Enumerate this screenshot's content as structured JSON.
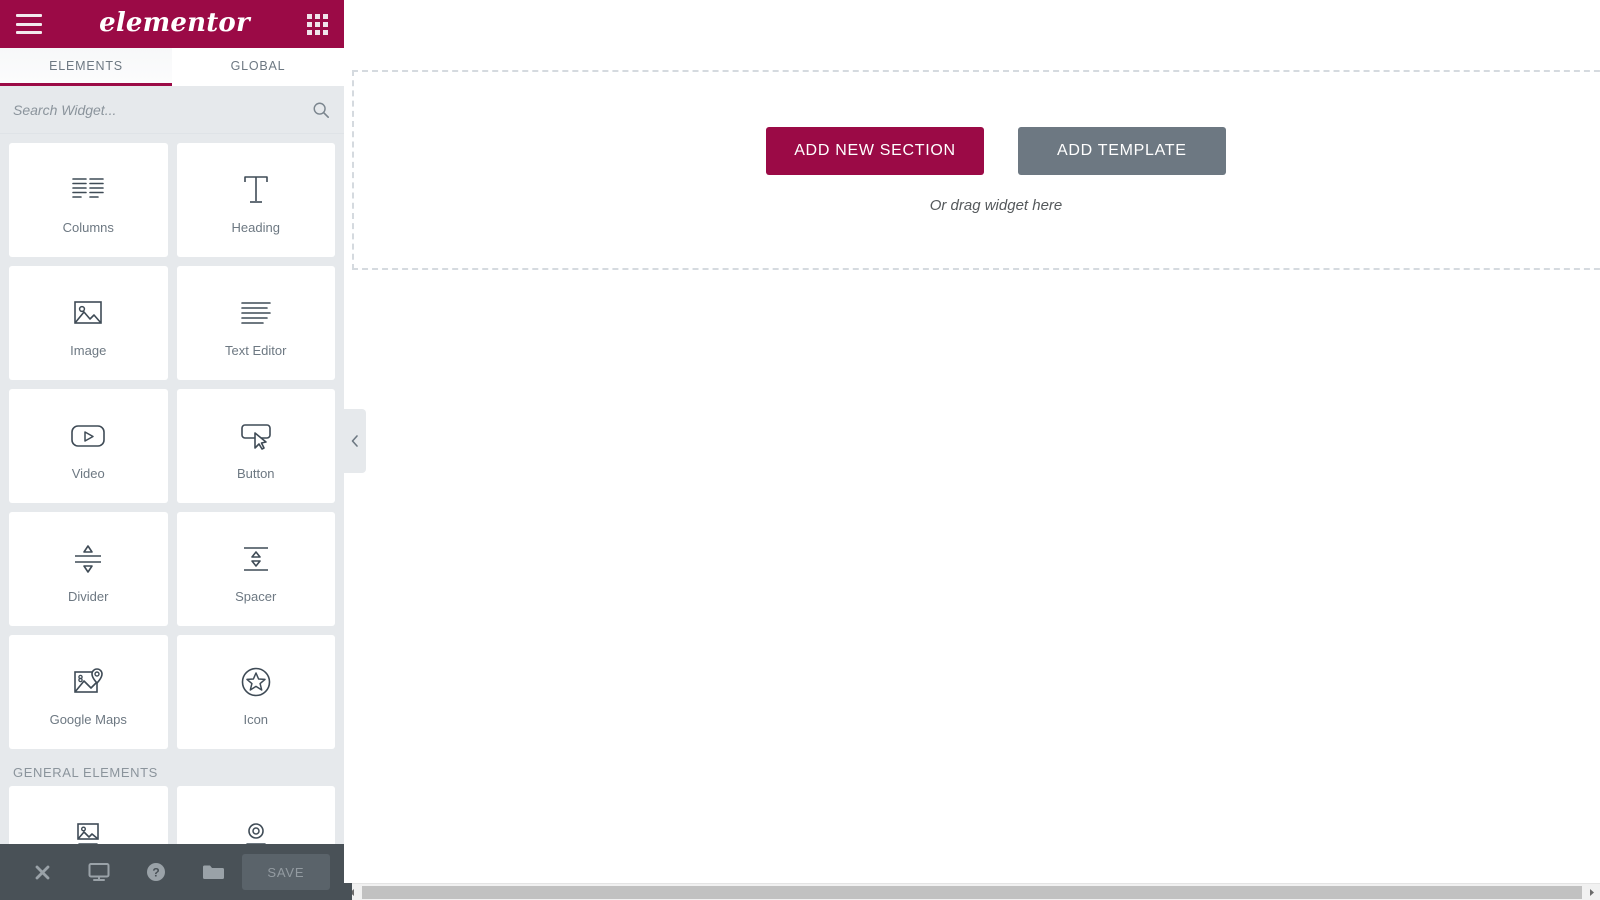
{
  "panel": {
    "header": {
      "menu_icon": "hamburger-icon",
      "logo": "elementor",
      "apps_icon": "grid-apps-icon"
    },
    "tabs": [
      {
        "label": "ELEMENTS",
        "active": true
      },
      {
        "label": "GLOBAL",
        "active": false
      }
    ],
    "search": {
      "placeholder": "Search Widget...",
      "value": "",
      "icon": "search-icon"
    },
    "widget_sections": [
      {
        "heading": "",
        "widgets": [
          {
            "label": "Columns",
            "icon": "columns-icon"
          },
          {
            "label": "Heading",
            "icon": "heading-t-icon"
          },
          {
            "label": "Image",
            "icon": "image-icon"
          },
          {
            "label": "Text Editor",
            "icon": "text-lines-icon"
          },
          {
            "label": "Video",
            "icon": "video-play-icon"
          },
          {
            "label": "Button",
            "icon": "button-cursor-icon"
          },
          {
            "label": "Divider",
            "icon": "divider-icon"
          },
          {
            "label": "Spacer",
            "icon": "spacer-icon"
          },
          {
            "label": "Google Maps",
            "icon": "map-pin-icon"
          },
          {
            "label": "Icon",
            "icon": "star-circle-icon"
          }
        ]
      },
      {
        "heading": "GENERAL ELEMENTS",
        "widgets": [
          {
            "label": "",
            "icon": "image-box-icon"
          },
          {
            "label": "",
            "icon": "icon-box-icon"
          }
        ]
      }
    ],
    "footer": {
      "buttons": [
        {
          "name": "close-button",
          "icon": "close-x-icon"
        },
        {
          "name": "responsive-mode-button",
          "icon": "desktop-icon"
        },
        {
          "name": "help-button",
          "icon": "question-circle-icon"
        },
        {
          "name": "library-button",
          "icon": "folder-icon"
        }
      ],
      "save_label": "SAVE"
    },
    "collapse_handle_icon": "chevron-left-icon"
  },
  "canvas": {
    "add_new_section_label": "ADD NEW SECTION",
    "add_template_label": "ADD TEMPLATE",
    "drag_hint": "Or drag widget here"
  },
  "scrollbar": {
    "left_arrow": "triangle-left-icon",
    "right_arrow": "triangle-right-icon"
  },
  "colors": {
    "brand": "#9b0a46",
    "panel_bg": "#e6e9ec",
    "footer_bg": "#495157",
    "secondary_button": "#6d7882",
    "text": "#6d7882"
  }
}
